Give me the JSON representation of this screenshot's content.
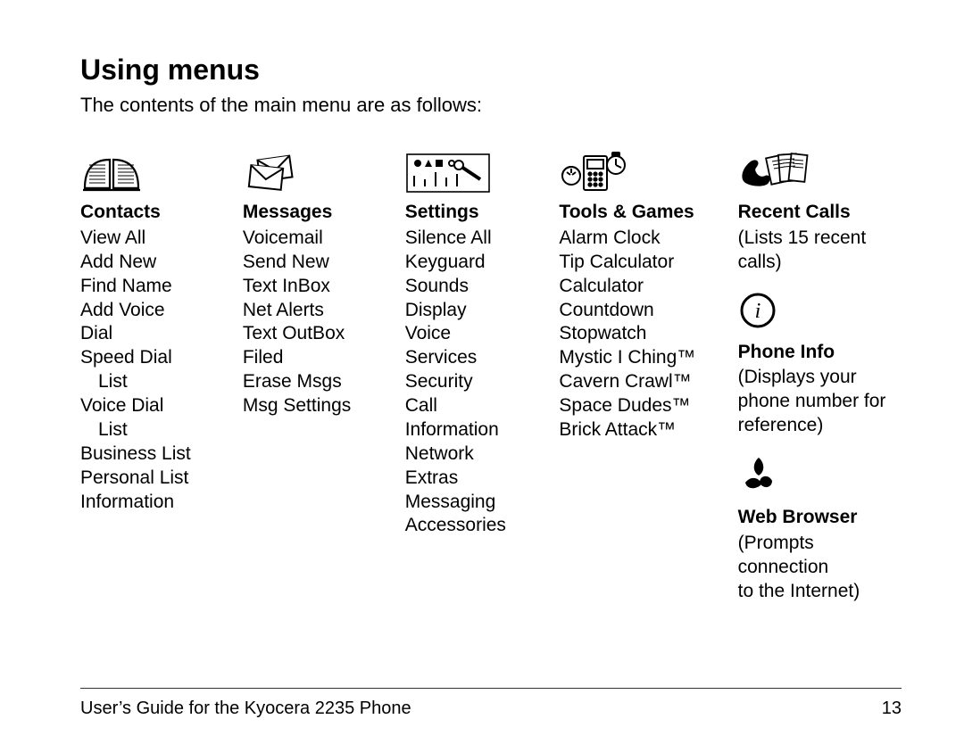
{
  "heading": "Using menus",
  "intro": "The contents of the main menu are as follows:",
  "cols": {
    "contacts": {
      "title": "Contacts",
      "items": [
        "View All",
        "Add New",
        "Find Name",
        "Add Voice",
        "Dial",
        "Speed Dial",
        "Voice Dial",
        "Business List",
        "Personal List",
        "Information"
      ],
      "indented": {
        "5": "List",
        "6": "List"
      }
    },
    "messages": {
      "title": "Messages",
      "items": [
        "Voicemail",
        "Send New",
        "Text InBox",
        "Net Alerts",
        "Text OutBox",
        "Filed",
        "Erase Msgs",
        "Msg Settings"
      ]
    },
    "settings": {
      "title": "Settings",
      "items": [
        "Silence All",
        "Keyguard",
        "Sounds",
        "Display",
        "Voice",
        "Services",
        "Security",
        "Call",
        "Information",
        "Network",
        "Extras",
        "Messaging",
        "Accessories"
      ]
    },
    "tools": {
      "title": "Tools & Games",
      "items": [
        "Alarm Clock",
        "Tip Calculator",
        "Calculator",
        "Countdown",
        "Stopwatch",
        "Mystic I Ching™",
        "Cavern Crawl™",
        "Space Dudes™",
        "Brick Attack™"
      ]
    },
    "right": {
      "recent_title": "Recent Calls",
      "recent_desc1": "(Lists 15 recent",
      "recent_desc2": "calls)",
      "phoneinfo_title": "Phone Info",
      "phoneinfo_desc1": "(Displays your",
      "phoneinfo_desc2": "phone number for",
      "phoneinfo_desc3": "reference)",
      "web_title": "Web Browser",
      "web_desc1": "(Prompts",
      "web_desc2": "connection",
      "web_desc3": "to the Internet)"
    }
  },
  "footer_left": "User’s Guide for the Kyocera 2235 Phone",
  "footer_right": "13"
}
